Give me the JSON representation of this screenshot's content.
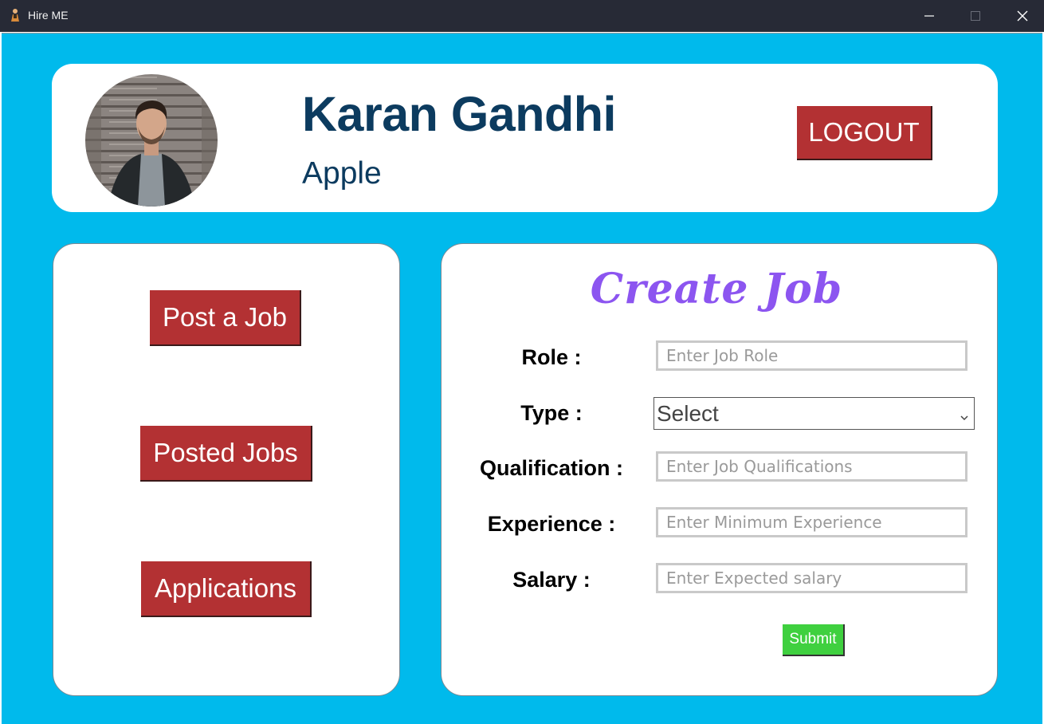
{
  "window": {
    "title": "Hire ME",
    "app_icon": "person-icon"
  },
  "header": {
    "user_name": "Karan Gandhi",
    "company": "Apple",
    "logout_label": "LOGOUT",
    "avatar": "profile-photo"
  },
  "sidebar": {
    "items": [
      {
        "label": "Post a Job"
      },
      {
        "label": "Posted Jobs"
      },
      {
        "label": "Applications"
      }
    ]
  },
  "form": {
    "title": "Create Job",
    "fields": [
      {
        "label": "Role :",
        "placeholder": "Enter Job Role",
        "value": ""
      },
      {
        "label": "Type :",
        "selected": "Select"
      },
      {
        "label": "Qualification :",
        "placeholder": "Enter Job Qualifications",
        "value": ""
      },
      {
        "label": "Experience :",
        "placeholder": "Enter Minimum Experience",
        "value": ""
      },
      {
        "label": "Salary :",
        "placeholder": "Enter Expected salary",
        "value": ""
      }
    ],
    "submit_label": "Submit"
  },
  "colors": {
    "background": "#00baec",
    "title_bar": "#272a36",
    "primary_button": "#b33133",
    "submit_button": "#3fd03f",
    "heading_text": "#0c3b5f",
    "form_title": "#8c55f0"
  }
}
